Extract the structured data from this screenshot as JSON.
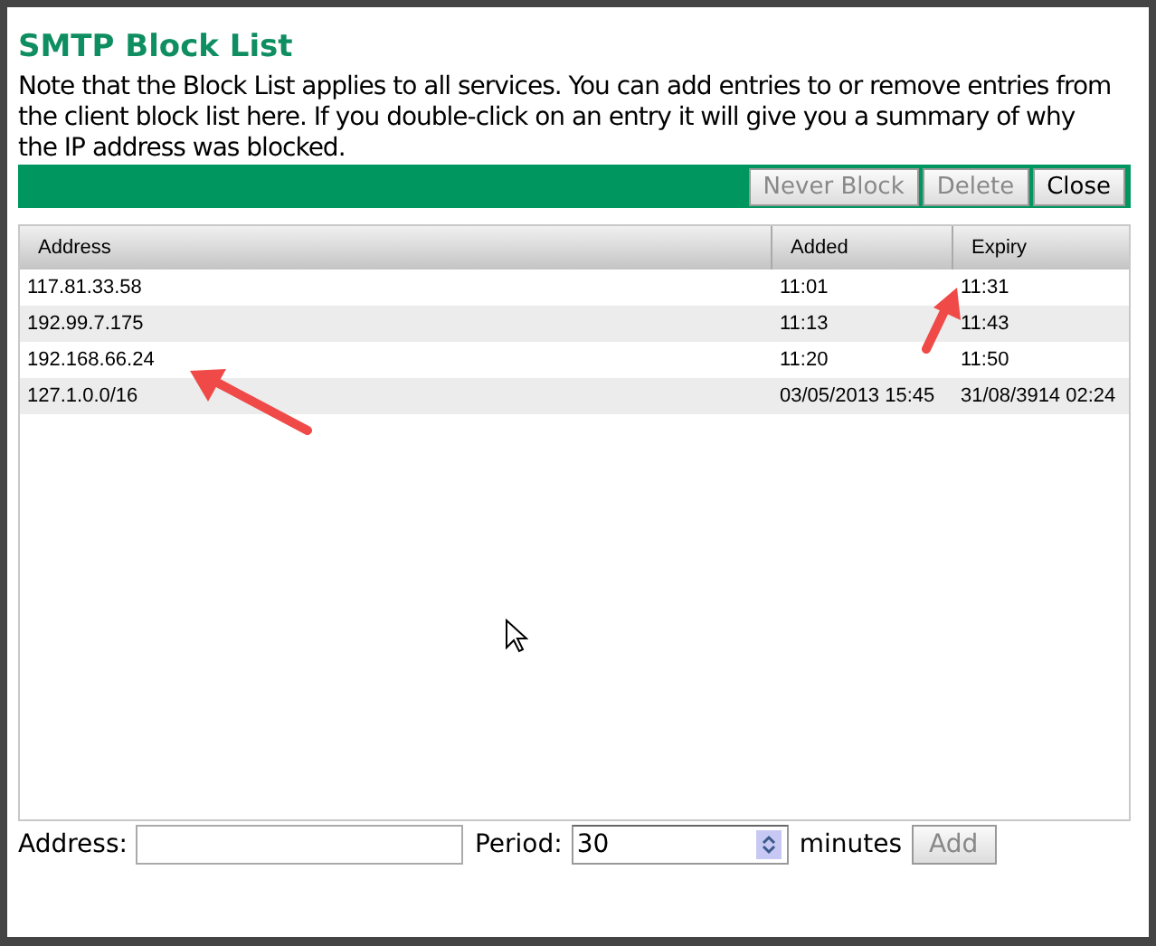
{
  "dialog": {
    "title": "SMTP Block List",
    "description": "Note that the Block List applies to all services. You can add entries to or remove entries from the client block list here. If you double-click on an entry it will give you a summary of why the IP address was blocked."
  },
  "toolbar": {
    "buttons": [
      {
        "label": "Never Block",
        "disabled": true
      },
      {
        "label": "Delete",
        "disabled": true
      },
      {
        "label": "Close",
        "disabled": false
      }
    ]
  },
  "table": {
    "columns": [
      "Address",
      "Added",
      "Expiry"
    ],
    "rows": [
      [
        "117.81.33.58",
        "11:01",
        "11:31"
      ],
      [
        "192.99.7.175",
        "11:13",
        "11:43"
      ],
      [
        "192.168.66.24",
        "11:20",
        "11:50"
      ],
      [
        "127.1.0.0/16",
        "03/05/2013 15:45",
        "31/08/3914 02:24"
      ]
    ]
  },
  "form": {
    "address_label": "Address:",
    "period_label": "Period:",
    "period_value": "30",
    "unit": "minutes",
    "add_button": {
      "label": "Add",
      "disabled": true
    }
  }
}
